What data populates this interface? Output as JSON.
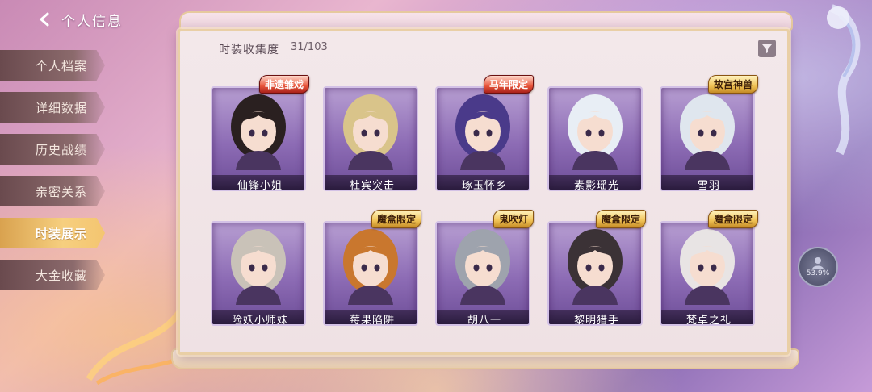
{
  "header": {
    "title": "个人信息"
  },
  "sidebar": {
    "items": [
      {
        "label": "个人档案"
      },
      {
        "label": "详细数据"
      },
      {
        "label": "历史战绩"
      },
      {
        "label": "亲密关系"
      },
      {
        "label": "时装展示",
        "active": true
      },
      {
        "label": "大金收藏"
      }
    ]
  },
  "collection": {
    "label": "时装收集度",
    "value": "31/103"
  },
  "cards": [
    {
      "name": "仙锋小姐",
      "badge": "非遗雏戏",
      "badge_color": "red",
      "hair": "#2a2020",
      "bg": "#9a7bbd"
    },
    {
      "name": "杜宾突击",
      "badge": "",
      "hair": "#d9c48a",
      "bg": "#9a7bbd"
    },
    {
      "name": "琢玉怀乡",
      "badge": "马年限定",
      "badge_color": "red",
      "hair": "#4a3a8a",
      "bg": "#9a7bbd"
    },
    {
      "name": "素影瑶光",
      "badge": "",
      "hair": "#e8eef5",
      "bg": "#9a7bbd"
    },
    {
      "name": "雪羽",
      "badge": "故宫神兽",
      "badge_color": "gold",
      "hair": "#dfe6ee",
      "bg": "#9a7bbd"
    },
    {
      "name": "险妖小师妹",
      "badge": "",
      "hair": "#c9c2b8",
      "bg": "#9a7bbd"
    },
    {
      "name": "莓果陷阱",
      "badge": "魔盒限定",
      "badge_color": "gold",
      "hair": "#c9772e",
      "bg": "#9a7bbd"
    },
    {
      "name": "胡八一",
      "badge": "鬼吹灯",
      "badge_color": "gold",
      "hair": "#9ea3ad",
      "bg": "#9a7bbd"
    },
    {
      "name": "黎明猎手",
      "badge": "魔盒限定",
      "badge_color": "gold",
      "hair": "#3b3236",
      "bg": "#9a7bbd"
    },
    {
      "name": "梵卓之礼",
      "badge": "魔盒限定",
      "badge_color": "gold",
      "hair": "#e8e4e4",
      "bg": "#9a7bbd"
    }
  ],
  "float_button": {
    "label": "53.9%"
  },
  "icons": {
    "back": "chevron-left-icon",
    "filter": "filter-icon"
  }
}
